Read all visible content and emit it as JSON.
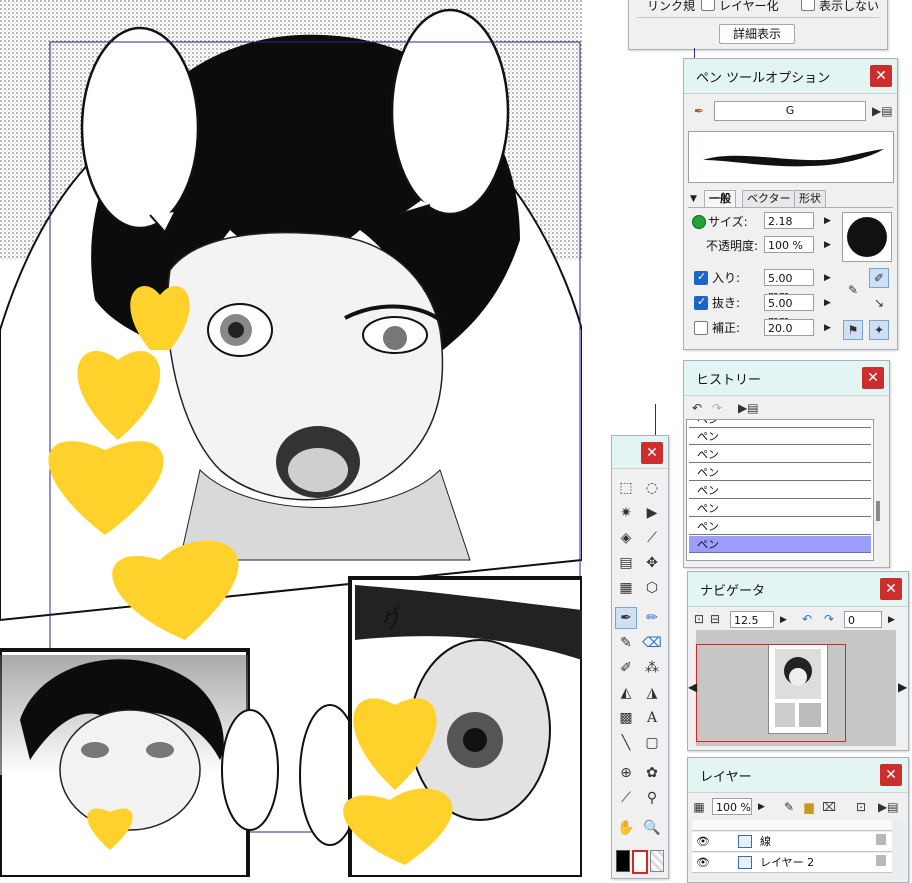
{
  "app": {
    "accent_close": "#cc2e2e",
    "title_bg": "#e3f5f2",
    "heart_color": "#ffd12b"
  },
  "top_panel": {
    "clip_label": "リンク規",
    "layerize_label": "レイヤー化",
    "hide_label": "表示しない",
    "details_button": "詳細表示"
  },
  "pen_options": {
    "title": "ペン ツールオプション",
    "brush_name": "G",
    "tabs": [
      "一般",
      "ベクター",
      "形状"
    ],
    "size_label": "サイズ:",
    "size_value": "2.18 mm",
    "opacity_label": "不透明度:",
    "opacity_value": "100 %",
    "start_label": "入り:",
    "start_value": "5.00 mm",
    "start_checked": true,
    "end_label": "抜き:",
    "end_value": "5.00 mm",
    "end_checked": true,
    "correction_label": "補正:",
    "correction_value": "20.0",
    "correction_checked": false,
    "close_icon": "close-icon"
  },
  "history": {
    "title": "ヒストリー",
    "items": [
      "ペン",
      "ペン",
      "ペン",
      "ペン",
      "ペン",
      "ペン",
      "ペン",
      "ペン"
    ],
    "selected_index": 7
  },
  "navigator": {
    "title": "ナビゲータ",
    "zoom": "12.5",
    "rotation": "0"
  },
  "layers": {
    "title": "レイヤー",
    "opacity": "100 %",
    "items": [
      "線",
      "レイヤー 2"
    ]
  },
  "tools": {
    "icons": [
      "marquee-icon",
      "lasso-icon",
      "magic-wand-icon",
      "object-select-icon",
      "layer-move-icon",
      "eyedropper-icon",
      "gradient-ruler-icon",
      "move-icon",
      "frame-icon",
      "transform-icon",
      "pen-icon",
      "pencil-icon",
      "marker-icon",
      "eraser-icon",
      "brush-icon",
      "airbrush-icon",
      "fill-icon",
      "bucket-icon",
      "gradation-icon",
      "text-icon",
      "line-icon",
      "rect-icon",
      "tone-icon",
      "tone-brush-icon",
      "correct-line-icon",
      "stamp-icon",
      "hand-icon",
      "zoom-icon"
    ]
  }
}
